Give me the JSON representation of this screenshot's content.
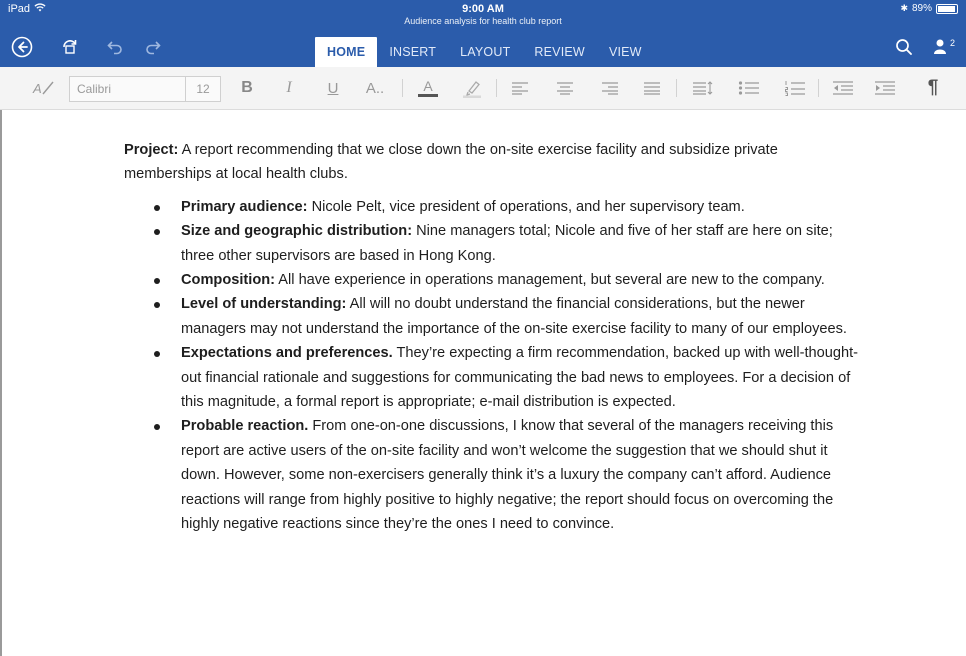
{
  "status_bar": {
    "device": "iPad",
    "time": "9:00 AM",
    "document_title": "Audience analysis for health club report",
    "battery": "89%"
  },
  "ribbon": {
    "tabs": [
      "HOME",
      "INSERT",
      "LAYOUT",
      "REVIEW",
      "VIEW"
    ],
    "active_tab": "HOME",
    "icons": [
      "back-icon",
      "file-sync-icon",
      "undo-icon",
      "redo-icon",
      "search-icon",
      "share-icon"
    ],
    "share_count": "2"
  },
  "toolbar": {
    "font_name": "Calibri",
    "font_size": "12",
    "bold": "B",
    "italic": "I",
    "underline": "U",
    "more_text": "A..",
    "font_color": "A",
    "paragraph_mark": "¶"
  },
  "colors": {
    "ribbon_blue": "#2b5cab",
    "toolbar_bg": "#f4f4f4",
    "font_color_underline": "#555555",
    "text": "#1e1e1e"
  },
  "document": {
    "project_label": "Project:",
    "project_text": " A report recommending that we close down the on-site exercise facility and subsidize private memberships at local health clubs.",
    "bullets": [
      {
        "label": "Primary audience:",
        "text": " Nicole Pelt, vice president of operations, and her supervisory team."
      },
      {
        "label": "Size and geographic distribution:",
        "text": " Nine managers total; Nicole and five of her staff are here on site; three other supervisors are based in Hong Kong."
      },
      {
        "label": "Composition:",
        "text": " All have experience in operations management, but several are new to the company."
      },
      {
        "label": "Level of understanding:",
        "text": " All will no doubt understand the financial considerations, but the newer managers may not understand the importance of the on-site exercise facility to many of our employees."
      },
      {
        "label": "Expectations and preferences.",
        "text": " They’re expecting a firm recommendation, backed up with well-thought-out financial rationale and suggestions for communicating the bad news to employees. For a decision of this magnitude, a formal report is appropriate; e-mail distribution is expected."
      },
      {
        "label": "Probable reaction.",
        "text": " From one-on-one discussions, I know that several of the managers receiving this report are active users of the on-site facility and won’t welcome the suggestion that we should shut it down. However, some non-exercisers generally think it’s a luxury the company can’t afford. Audience reactions will range from highly positive to highly negative; the report should focus on overcoming the highly negative reactions since they’re the ones I need to convince."
      }
    ]
  }
}
